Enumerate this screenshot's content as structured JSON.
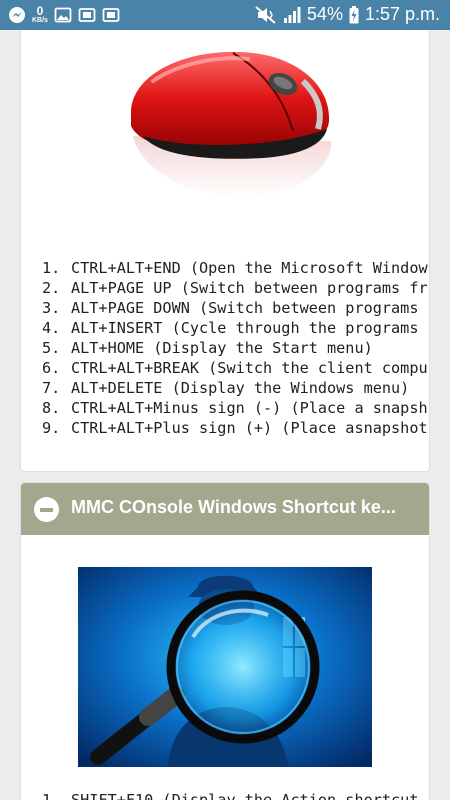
{
  "status_bar": {
    "icons": [
      "messenger-icon",
      "gallery-icon",
      "screenshot-icon",
      "screenshot-icon"
    ],
    "speed_value": "0",
    "speed_unit": "KB/s",
    "battery": "54%",
    "time": "1:57 p.m."
  },
  "card1": {
    "image": "red-computer-mouse",
    "items": [
      {
        "num": "1.",
        "text": "CTRL+ALT+END (Open the Microsoft Window"
      },
      {
        "num": "2.",
        "text": "ALT+PAGE UP (Switch between programs fr"
      },
      {
        "num": "3.",
        "text": "ALT+PAGE DOWN (Switch between programs "
      },
      {
        "num": "4.",
        "text": "ALT+INSERT (Cycle through the programs "
      },
      {
        "num": "5.",
        "text": "ALT+HOME (Display the Start menu)"
      },
      {
        "num": "6.",
        "text": "CTRL+ALT+BREAK (Switch the client compu"
      },
      {
        "num": "7.",
        "text": "ALT+DELETE (Display the Windows menu)"
      },
      {
        "num": "8.",
        "text": "CTRL+ALT+Minus sign (-) (Place a snapsh"
      },
      {
        "num": "9.",
        "text": "CTRL+ALT+Plus sign (+) (Place asnapshot"
      }
    ]
  },
  "card2": {
    "title": "MMC COnsole Windows Shortcut ke...",
    "image": "magnifying-glass-spy",
    "items": [
      {
        "num": "1.",
        "text": "SHIFT+F10 (Display the Action shortcut"
      }
    ]
  },
  "colors": {
    "status_bar": "#4a83a8",
    "header": "#a4a68e"
  }
}
